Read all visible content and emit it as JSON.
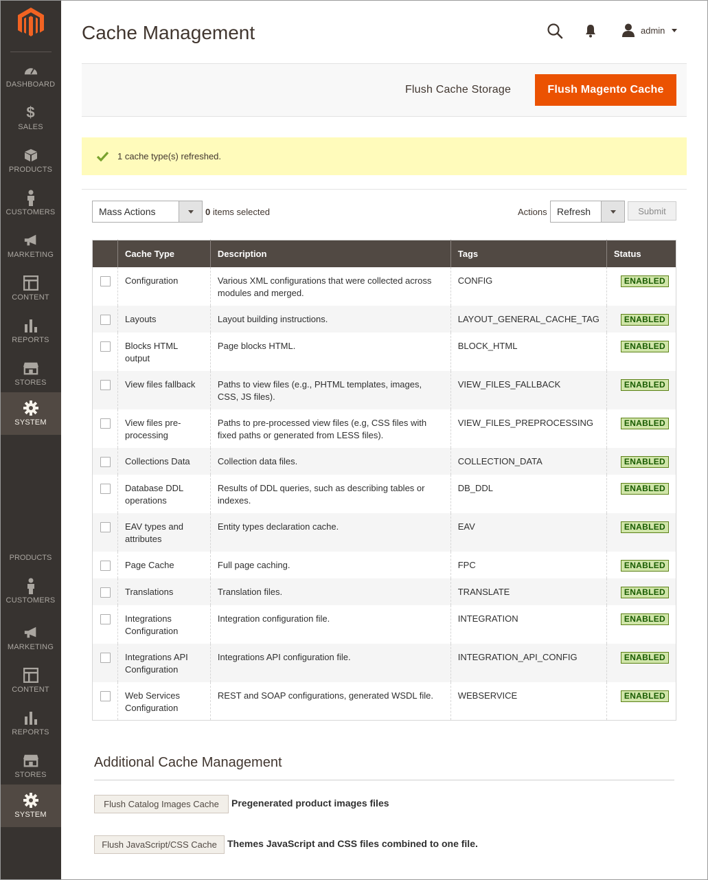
{
  "sidebar": {
    "top_items": [
      {
        "label": "DASHBOARD",
        "icon": "dashboard-icon"
      },
      {
        "label": "SALES",
        "icon": "dollar-icon"
      },
      {
        "label": "PRODUCTS",
        "icon": "box-icon"
      },
      {
        "label": "CUSTOMERS",
        "icon": "person-icon"
      },
      {
        "label": "MARKETING",
        "icon": "megaphone-icon"
      },
      {
        "label": "CONTENT",
        "icon": "layout-icon"
      },
      {
        "label": "REPORTS",
        "icon": "bar-chart-icon"
      },
      {
        "label": "STORES",
        "icon": "store-icon"
      },
      {
        "label": "SYSTEM",
        "icon": "gear-icon"
      }
    ],
    "bottom_text": "PRODUCTS",
    "bottom_items": [
      {
        "label": "CUSTOMERS",
        "icon": "person-icon"
      },
      {
        "label": "MARKETING",
        "icon": "megaphone-icon"
      },
      {
        "label": "CONTENT",
        "icon": "layout-icon"
      },
      {
        "label": "REPORTS",
        "icon": "bar-chart-icon"
      },
      {
        "label": "STORES",
        "icon": "store-icon"
      },
      {
        "label": "SYSTEM",
        "icon": "gear-icon"
      }
    ]
  },
  "header": {
    "title": "Cache Management",
    "user": "admin"
  },
  "action_bar": {
    "flush_storage": "Flush Cache Storage",
    "flush_magento": "Flush Magento Cache"
  },
  "message": "1 cache type(s) refreshed.",
  "toolbar": {
    "mass_actions": "Mass Actions",
    "selected_count": "0",
    "selected_text": " items selected",
    "actions_label": "Actions",
    "actions_value": "Refresh",
    "submit": "Submit"
  },
  "table": {
    "headers": [
      "",
      "Cache Type",
      "Description",
      "Tags",
      "Status"
    ],
    "rows": [
      {
        "type": "Configuration",
        "description": "Various XML configurations that were collected across modules and merged.",
        "tags": "CONFIG",
        "status": "ENABLED"
      },
      {
        "type": "Layouts",
        "description": "Layout building instructions.",
        "tags": "LAYOUT_GENERAL_CACHE_TAG",
        "status": "ENABLED"
      },
      {
        "type": "Blocks HTML output",
        "description": "Page blocks HTML.",
        "tags": "BLOCK_HTML",
        "status": "ENABLED"
      },
      {
        "type": "View files fallback",
        "description": "Paths to view files (e.g., PHTML templates, images, CSS, JS files).",
        "tags": "VIEW_FILES_FALLBACK",
        "status": "ENABLED"
      },
      {
        "type": "View files pre-processing",
        "description": "Paths to pre-processed view files (e.g, CSS files with fixed paths or generated from LESS files).",
        "tags": "VIEW_FILES_PREPROCESSING",
        "status": "ENABLED"
      },
      {
        "type": "Collections Data",
        "description": "Collection data files.",
        "tags": "COLLECTION_DATA",
        "status": "ENABLED"
      },
      {
        "type": "Database DDL operations",
        "description": "Results of DDL queries, such as describing tables or indexes.",
        "tags": "DB_DDL",
        "status": "ENABLED"
      },
      {
        "type": "EAV types and attributes",
        "description": "Entity types declaration cache.",
        "tags": "EAV",
        "status": "ENABLED"
      },
      {
        "type": "Page Cache",
        "description": "Full page caching.",
        "tags": "FPC",
        "status": "ENABLED"
      },
      {
        "type": "Translations",
        "description": "Translation files.",
        "tags": "TRANSLATE",
        "status": "ENABLED"
      },
      {
        "type": "Integrations Configuration",
        "description": "Integration configuration file.",
        "tags": "INTEGRATION",
        "status": "ENABLED"
      },
      {
        "type": "Integrations API Configuration",
        "description": "Integrations API configuration file.",
        "tags": "INTEGRATION_API_CONFIG",
        "status": "ENABLED"
      },
      {
        "type": "Web Services Configuration",
        "description": "REST and SOAP configurations, generated WSDL file.",
        "tags": "WEBSERVICE",
        "status": "ENABLED"
      }
    ]
  },
  "additional": {
    "title": "Additional Cache Management",
    "items": [
      {
        "button": "Flush Catalog Images Cache",
        "description": "Pregenerated product images files"
      },
      {
        "button": "Flush JavaScript/CSS Cache",
        "description": "Themes JavaScript and CSS files combined to one file."
      }
    ]
  },
  "colors": {
    "sidebar_bg": "#373330",
    "accent": "#eb5202",
    "table_header": "#514943",
    "message_bg": "#fffbbb",
    "badge_bg": "#d0e5a9"
  }
}
